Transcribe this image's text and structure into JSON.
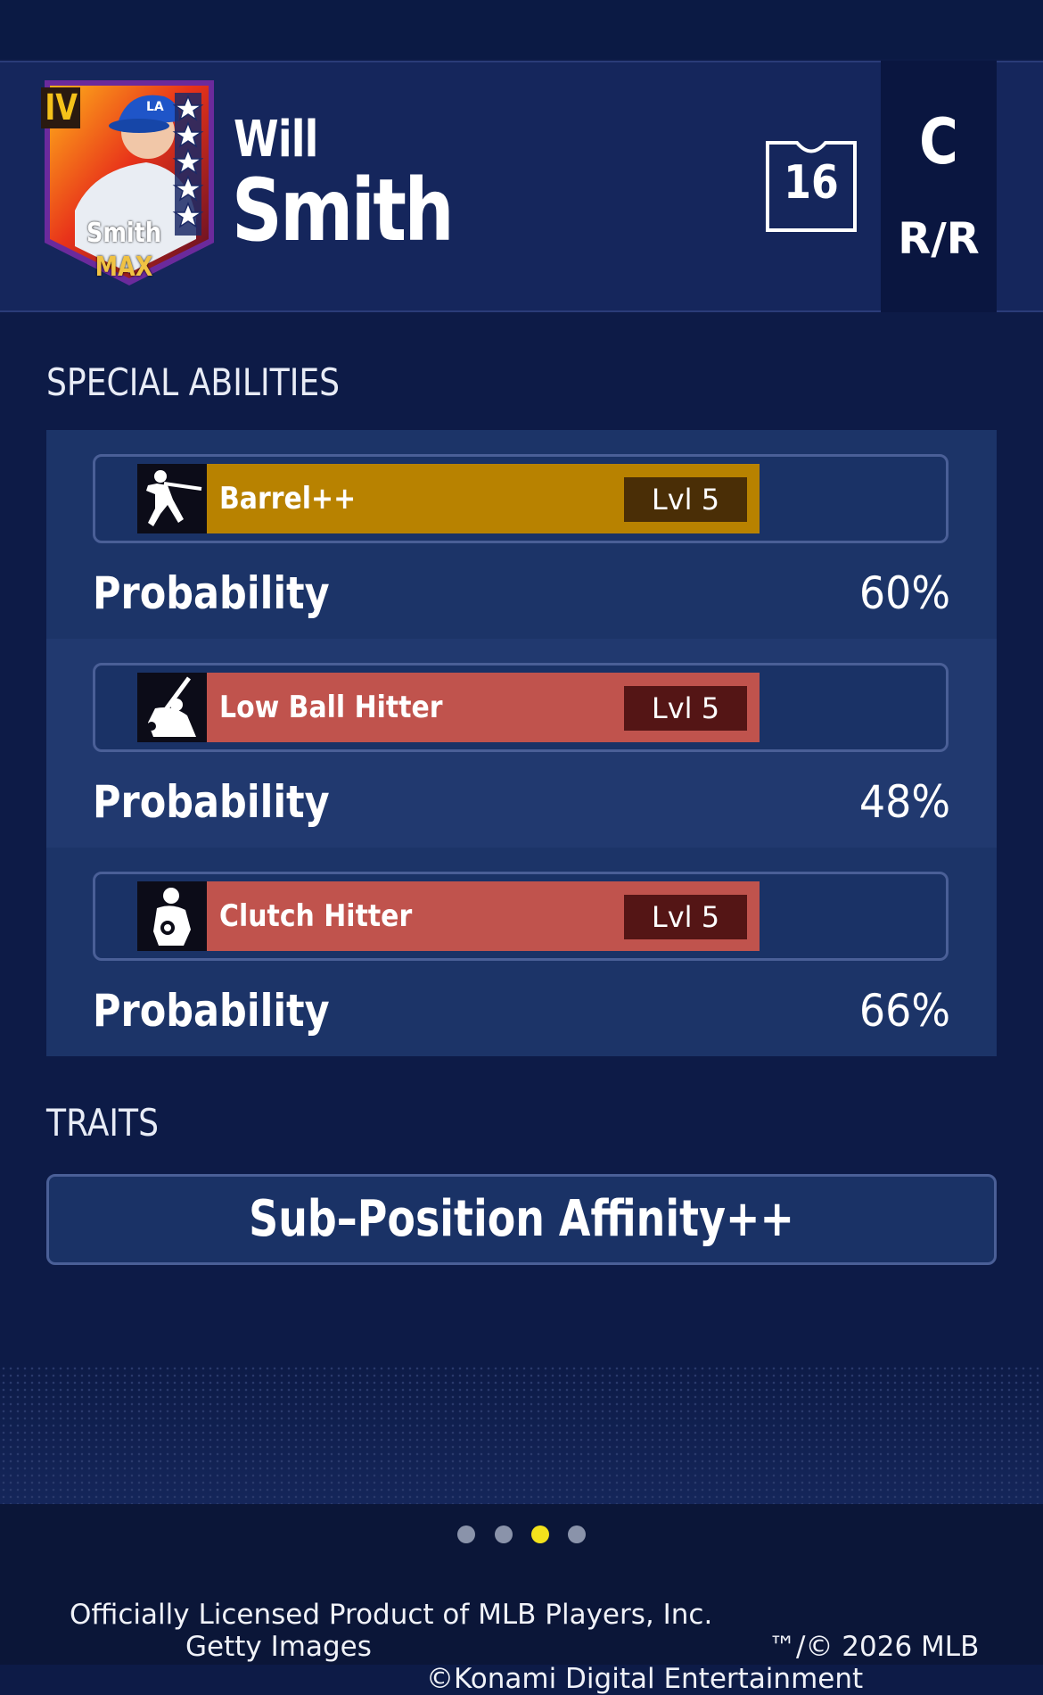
{
  "player": {
    "first_name": "Will",
    "last_name": "Smith",
    "card_name": "Smith",
    "card_rank": "MAX",
    "card_tier": "IV",
    "jersey_number": "16",
    "position": "C",
    "bats_throws": "R/R"
  },
  "special_abilities": {
    "title": "SPECIAL ABILITIES",
    "items": [
      {
        "name": "Barrel++",
        "level": "Lvl 5",
        "probability_label": "Probability",
        "probability": "60%",
        "color": "#b88200",
        "icon": "batter-swing-icon"
      },
      {
        "name": "Low Ball Hitter",
        "level": "Lvl 5",
        "probability_label": "Probability",
        "probability": "48%",
        "color": "#c0534d",
        "icon": "low-ball-hitter-icon"
      },
      {
        "name": "Clutch Hitter",
        "level": "Lvl 5",
        "probability_label": "Probability",
        "probability": "66%",
        "color": "#c0534d",
        "icon": "clutch-hitter-icon"
      }
    ]
  },
  "traits": {
    "title": "TRAITS",
    "items": [
      "Sub–Position Affinity++"
    ]
  },
  "pagination": {
    "total": 4,
    "active_index": 2
  },
  "footer": {
    "line1_left": "Officially Licensed Product of MLB Players, Inc.",
    "line1_right": "™/© 2026 MLB",
    "line2_left": "Getty Images",
    "line2_right": "©Konami Digital Entertainment"
  }
}
